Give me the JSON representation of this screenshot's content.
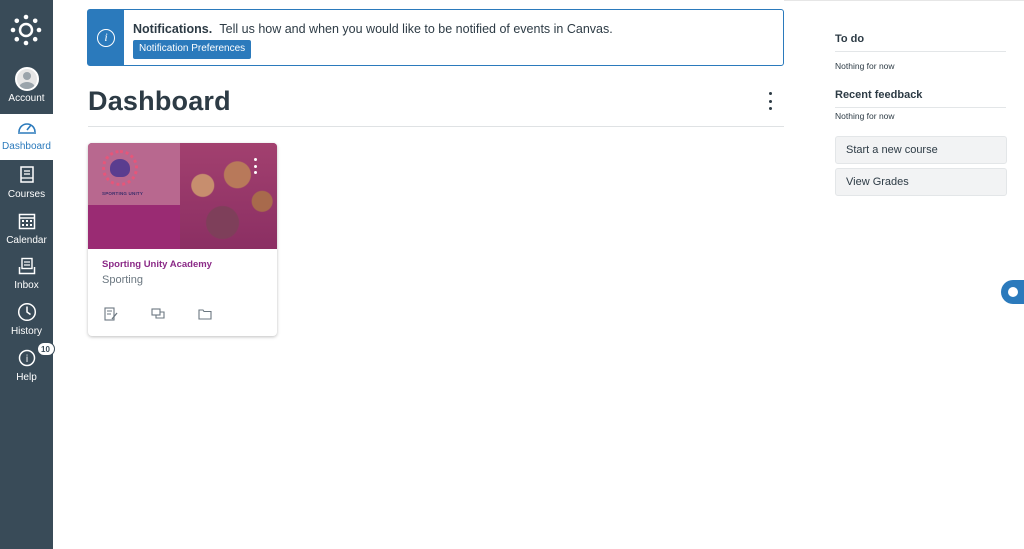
{
  "nav": {
    "items": [
      {
        "label": "Account",
        "icon": "account-avatar-icon"
      },
      {
        "label": "Dashboard",
        "icon": "dashboard-speedometer-icon"
      },
      {
        "label": "Courses",
        "icon": "courses-book-icon"
      },
      {
        "label": "Calendar",
        "icon": "calendar-icon"
      },
      {
        "label": "Inbox",
        "icon": "inbox-icon"
      },
      {
        "label": "History",
        "icon": "history-clock-icon"
      },
      {
        "label": "Help",
        "icon": "help-icon"
      }
    ],
    "help_badge": "10",
    "active": "Dashboard"
  },
  "notification": {
    "title": "Notifications.",
    "message": "Tell us how and when you would like to be notified of events in Canvas.",
    "button": "Notification Preferences"
  },
  "header": {
    "title": "Dashboard"
  },
  "course_card": {
    "title": "Sporting Unity Academy",
    "subtitle": "Sporting",
    "logo_text": "SPORTING UNITY",
    "color": "#9a2b73"
  },
  "sidebar": {
    "todo_heading": "To do",
    "todo_note": "Nothing for now",
    "feedback_heading": "Recent feedback",
    "feedback_note": "Nothing for now",
    "start_course": "Start a new course",
    "view_grades": "View Grades"
  },
  "colors": {
    "nav_bg": "#394b58",
    "accent": "#2b7abc",
    "course_link": "#8b2a87"
  }
}
